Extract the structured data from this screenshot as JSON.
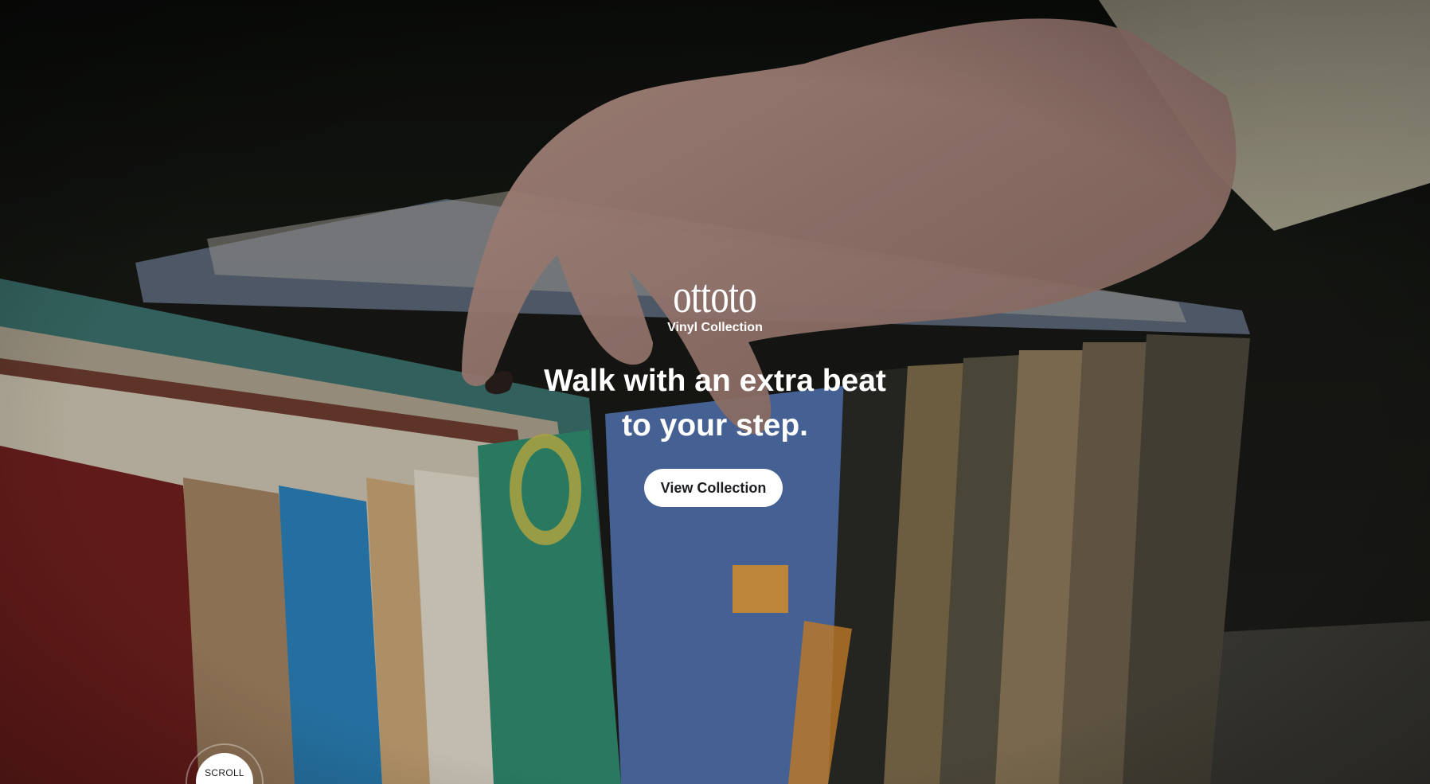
{
  "brand": {
    "logo_text": "ottoto",
    "subtitle": "Vinyl Collection"
  },
  "hero": {
    "headline_line1": "Walk with an extra beat",
    "headline_line2": "to your step.",
    "cta_label": "View Collection",
    "scroll_label": "SCROLL",
    "background_image": "hand flipping through vinyl record sleeves"
  },
  "colors": {
    "text": "#ffffff",
    "button_bg": "#ffffff",
    "button_text": "#1b1d20",
    "background_dark": "#131410"
  }
}
